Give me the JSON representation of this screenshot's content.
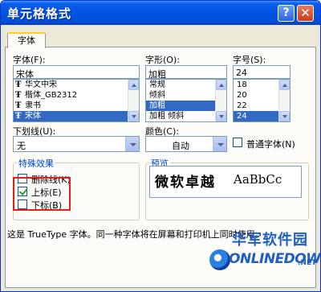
{
  "window": {
    "title": "单元格格式",
    "help_glyph": "?",
    "close_glyph": "✕"
  },
  "tab": {
    "label": "字体"
  },
  "font": {
    "label": "字体(F):",
    "value": "宋体",
    "items": [
      {
        "icon": "truetype-icon",
        "label": "华文中宋",
        "selected": false
      },
      {
        "icon": "truetype-icon",
        "label": "楷体_GB2312",
        "selected": false
      },
      {
        "icon": "truetype-icon",
        "label": "隶书",
        "selected": false
      },
      {
        "icon": "truetype-icon",
        "label": "宋体",
        "selected": true
      }
    ]
  },
  "style": {
    "label": "字形(O):",
    "value": "加粗",
    "items": [
      {
        "label": "常规",
        "selected": false
      },
      {
        "label": "倾斜",
        "selected": false
      },
      {
        "label": "加粗",
        "selected": true
      },
      {
        "label": "加粗 倾斜",
        "selected": false
      }
    ]
  },
  "size": {
    "label": "字号(S):",
    "value": "24",
    "items": [
      {
        "label": "18",
        "selected": false
      },
      {
        "label": "20",
        "selected": false
      },
      {
        "label": "22",
        "selected": false
      },
      {
        "label": "24",
        "selected": true
      }
    ]
  },
  "underline": {
    "label": "下划线(U):",
    "value": "无"
  },
  "color": {
    "label": "颜色(C):",
    "value": "自动"
  },
  "normal_font": {
    "label": "普通字体(N)",
    "checked": false
  },
  "effects": {
    "title": "特殊效果",
    "strikethrough": {
      "label": "删除线(K)",
      "checked": false
    },
    "superscript": {
      "label": "上标(E)",
      "checked": true
    },
    "subscript": {
      "label": "下标(B)",
      "checked": false
    }
  },
  "preview": {
    "title": "预览",
    "sample_cn": "微软卓越",
    "sample_en": "AaBbCc"
  },
  "note": "这是 TrueType 字体。同一种字体将在屏幕和打印机上同时使用。",
  "watermark": {
    "cn": "华军软件园",
    "en": "ONLINEDOWN",
    "suffix": ".NET"
  },
  "colors": {
    "titlebar": "#0054e3",
    "selection": "#316ac5",
    "highlight_box": "#e02020",
    "tab_accent": "#ffc83c"
  }
}
